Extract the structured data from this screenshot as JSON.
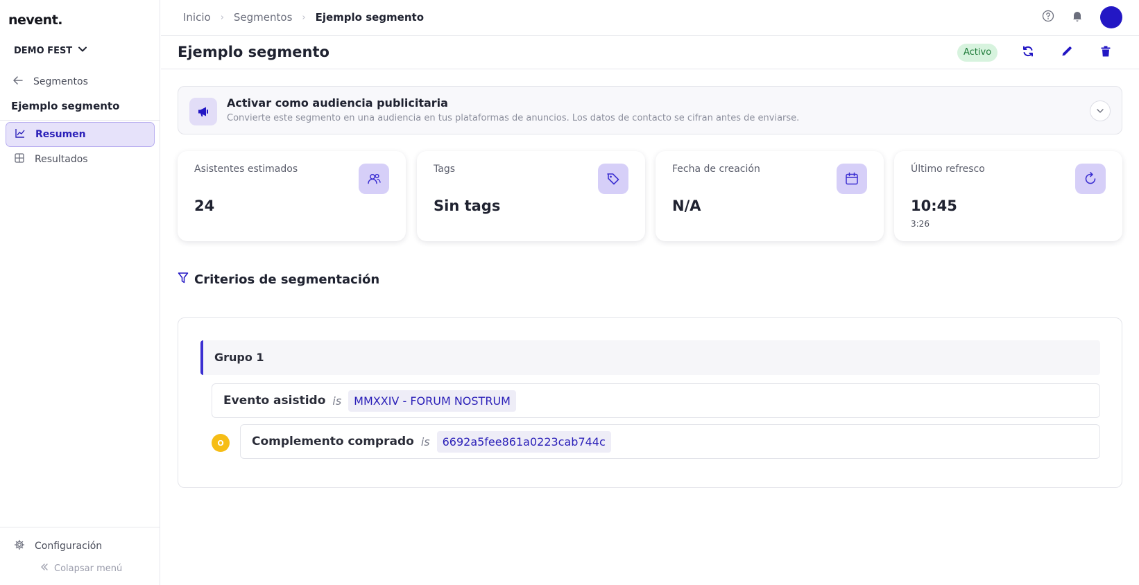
{
  "app": {
    "logo": "nevent."
  },
  "sidebar": {
    "org_name": "DEMO FEST",
    "back_label": "Segmentos",
    "segment_name": "Ejemplo segmento",
    "items": [
      {
        "label": "Resumen",
        "icon": "chart-line-icon",
        "active": true
      },
      {
        "label": "Resultados",
        "icon": "table-icon",
        "active": false
      }
    ],
    "config_label": "Configuración",
    "collapse_label": "Colapsar menú"
  },
  "breadcrumb": {
    "items": [
      "Inicio",
      "Segmentos"
    ],
    "current": "Ejemplo segmento"
  },
  "header": {
    "title": "Ejemplo segmento",
    "status": "Activo",
    "actions": [
      "refresh-icon",
      "edit-icon",
      "delete-icon"
    ]
  },
  "banner": {
    "title": "Activar como audiencia publicitaria",
    "subtitle": "Convierte este segmento en una audiencia en tus plataformas de anuncios. Los datos de contacto se cifran antes de enviarse."
  },
  "stats": [
    {
      "label": "Asistentes estimados",
      "value": "24",
      "sub": "",
      "icon": "users-icon"
    },
    {
      "label": "Tags",
      "value": "Sin tags",
      "sub": "",
      "icon": "tag-icon"
    },
    {
      "label": "Fecha de creación",
      "value": "N/A",
      "sub": "",
      "icon": "calendar-icon"
    },
    {
      "label": "Último refresco",
      "value": "10:45",
      "sub": "3:26",
      "icon": "refresh-icon"
    }
  ],
  "criteria": {
    "title": "Criterios de segmentación",
    "group_label": "Grupo 1",
    "or_badge": "O",
    "conditions": [
      {
        "field": "Evento asistido",
        "operator": "is",
        "value": "MMXXIV - FORUM NOSTRUM"
      },
      {
        "field": "Complemento comprado",
        "operator": "is",
        "value": "6692a5fee861a0223cab744c"
      }
    ]
  },
  "colors": {
    "primary": "#2317c4",
    "accent_light": "#e6e2fa",
    "status_bg": "#d7f3de",
    "status_text": "#1d7a38",
    "or_badge": "#f6bd16"
  }
}
